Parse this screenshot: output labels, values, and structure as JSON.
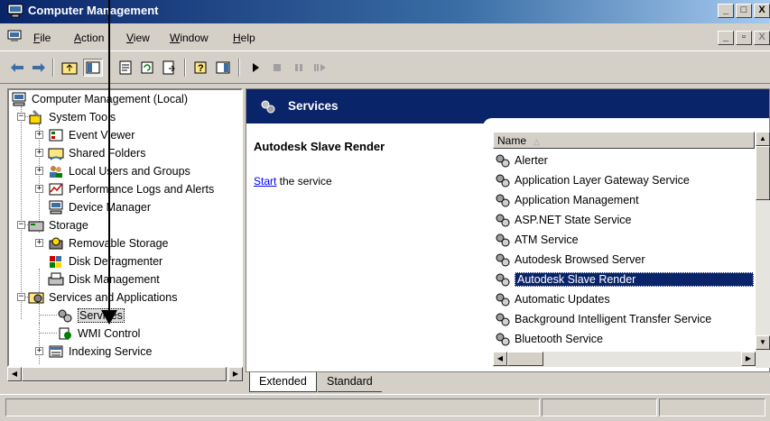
{
  "window": {
    "title": "Computer Management",
    "caption_minimize": "_",
    "caption_maximize": "□",
    "caption_close": "X"
  },
  "menubar": {
    "items": [
      {
        "acc": "F",
        "rest": "ile"
      },
      {
        "acc": "A",
        "rest": "ction"
      },
      {
        "acc": "V",
        "rest": "iew"
      },
      {
        "acc": "W",
        "rest": "indow"
      },
      {
        "acc": "H",
        "rest": "elp"
      }
    ],
    "mdi_minimize": "_",
    "mdi_restore": "▫",
    "mdi_close": "X"
  },
  "tree": {
    "items": [
      {
        "label": "Computer Management (Local)",
        "icon": "computer-icon"
      },
      {
        "label": "System Tools",
        "icon": "system-tools-icon"
      },
      {
        "label": "Event Viewer",
        "icon": "event-viewer-icon"
      },
      {
        "label": "Shared Folders",
        "icon": "shared-folders-icon"
      },
      {
        "label": "Local Users and Groups",
        "icon": "users-groups-icon"
      },
      {
        "label": "Performance Logs and Alerts",
        "icon": "performance-logs-icon"
      },
      {
        "label": "Device Manager",
        "icon": "device-manager-icon"
      },
      {
        "label": "Storage",
        "icon": "storage-icon"
      },
      {
        "label": "Removable Storage",
        "icon": "removable-storage-icon"
      },
      {
        "label": "Disk Defragmenter",
        "icon": "disk-defragmenter-icon"
      },
      {
        "label": "Disk Management",
        "icon": "disk-management-icon"
      },
      {
        "label": "Services and Applications",
        "icon": "services-applications-icon"
      },
      {
        "label": "Services",
        "icon": "services-gears-icon"
      },
      {
        "label": "WMI Control",
        "icon": "wmi-control-icon"
      },
      {
        "label": "Indexing Service",
        "icon": "indexing-service-icon"
      }
    ]
  },
  "services_pane": {
    "header_title": "Services",
    "selected_service_name": "Autodesk Slave Render",
    "action_link": "Start",
    "action_rest": " the service",
    "column_name": "Name",
    "column_sort_glyph": "△",
    "rows": [
      "Alerter",
      "Application Layer Gateway Service",
      "Application Management",
      "ASP.NET State Service",
      "ATM Service",
      "Autodesk Browsed Server",
      "Autodesk Slave Render",
      "Automatic Updates",
      "Background Intelligent Transfer Service",
      "Bluetooth Service"
    ],
    "selected_index": 6
  },
  "tabs": {
    "extended": "Extended",
    "standard": "Standard"
  },
  "colors": {
    "title_gradient_start": "#0a246a",
    "title_gradient_end": "#a6caf0",
    "selection": "#0a246a",
    "face": "#d4d0c8"
  }
}
